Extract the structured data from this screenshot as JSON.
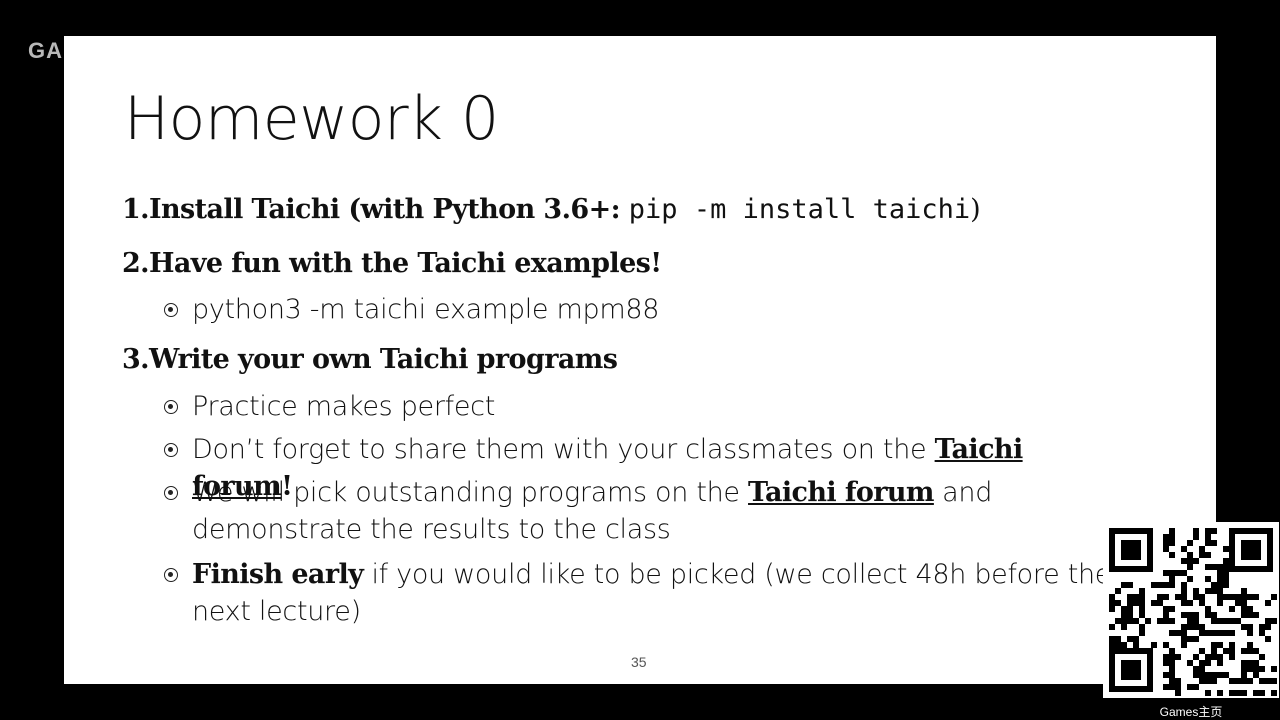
{
  "watermark": "GAMES",
  "slide": {
    "title": "Homework 0",
    "item1": {
      "prefix": "1.Install Taichi (with Python 3.6+: ",
      "code": "pip -m install taichi",
      "suffix": ")"
    },
    "item2": "2.Have fun with the Taichi examples!",
    "item2_bullets": [
      "python3 -m taichi example mpm88"
    ],
    "item3": "3.Write your own Taichi programs",
    "item3_bullets": {
      "b1": "Practice makes perfect",
      "b2_pre": "Don’t forget to share them with your classmates on the ",
      "b2_link": "Taichi forum",
      "b2_post": "!",
      "b3_pre": "We will pick outstanding programs on the ",
      "b3_link": "Taichi forum",
      "b3_post": " and demonstrate the results to the class",
      "b4_bold": "Finish early",
      "b4_post": " if you would like to be picked (we collect 48h before the next lecture)"
    },
    "page_number": "35"
  },
  "qr": {
    "icon": "qr-code-icon",
    "label": "Games主页"
  }
}
